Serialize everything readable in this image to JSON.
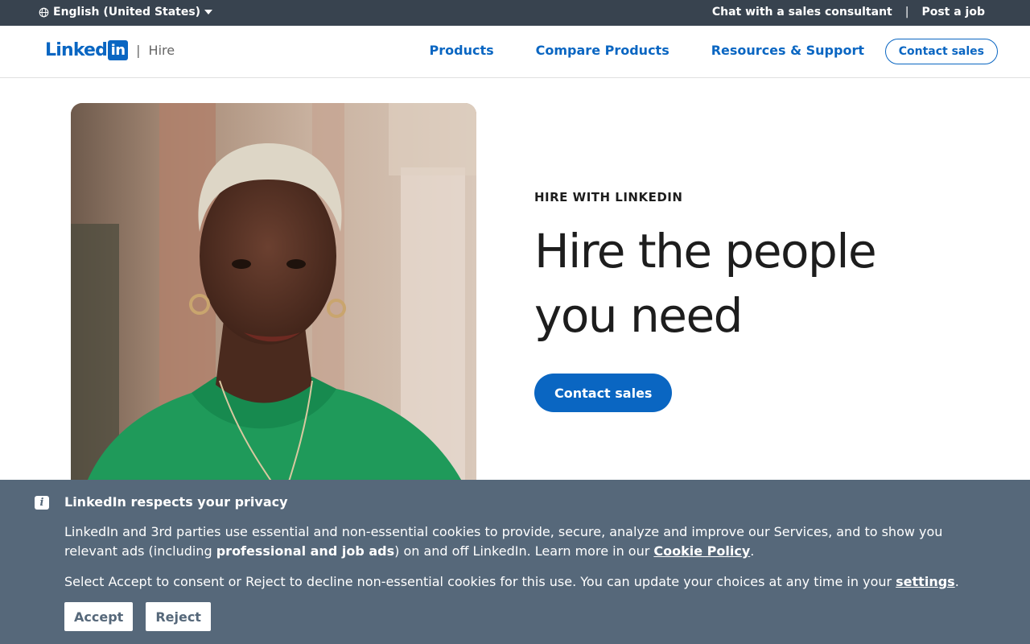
{
  "utility": {
    "language": "English (United States)",
    "chat": "Chat with a sales consultant",
    "separator": "|",
    "post_job": "Post a job"
  },
  "nav": {
    "logo_text": "Linked",
    "logo_badge": "in",
    "logo_separator": "|",
    "logo_sub": "Hire",
    "links": [
      {
        "label": "Products"
      },
      {
        "label": "Compare Products"
      },
      {
        "label": "Resources & Support"
      }
    ],
    "cta": "Contact sales"
  },
  "hero": {
    "eyebrow": "HIRE WITH LINKEDIN",
    "headline": "Hire the people you need",
    "cta": "Contact sales",
    "image_icon": "woman-portrait-photo"
  },
  "cookie": {
    "icon": "info-icon",
    "icon_glyph": "i",
    "title": "LinkedIn respects your privacy",
    "p1_pre": "LinkedIn and 3rd parties use essential and non-essential cookies to provide, secure, analyze and improve our Services, and to show you relevant ads (including ",
    "p1_bold": "professional and job ads",
    "p1_mid": ") on and off LinkedIn. Learn more in our ",
    "p1_link": "Cookie Policy",
    "p1_end": ".",
    "p2_pre": "Select Accept to consent or Reject to decline non-essential cookies for this use. You can update your choices at any time in your ",
    "p2_link": "settings",
    "p2_end": ".",
    "accept": "Accept",
    "reject": "Reject"
  },
  "colors": {
    "brand": "#0a66c2",
    "utility_bar": "#38434f",
    "cookie_bg": "#56687a"
  }
}
